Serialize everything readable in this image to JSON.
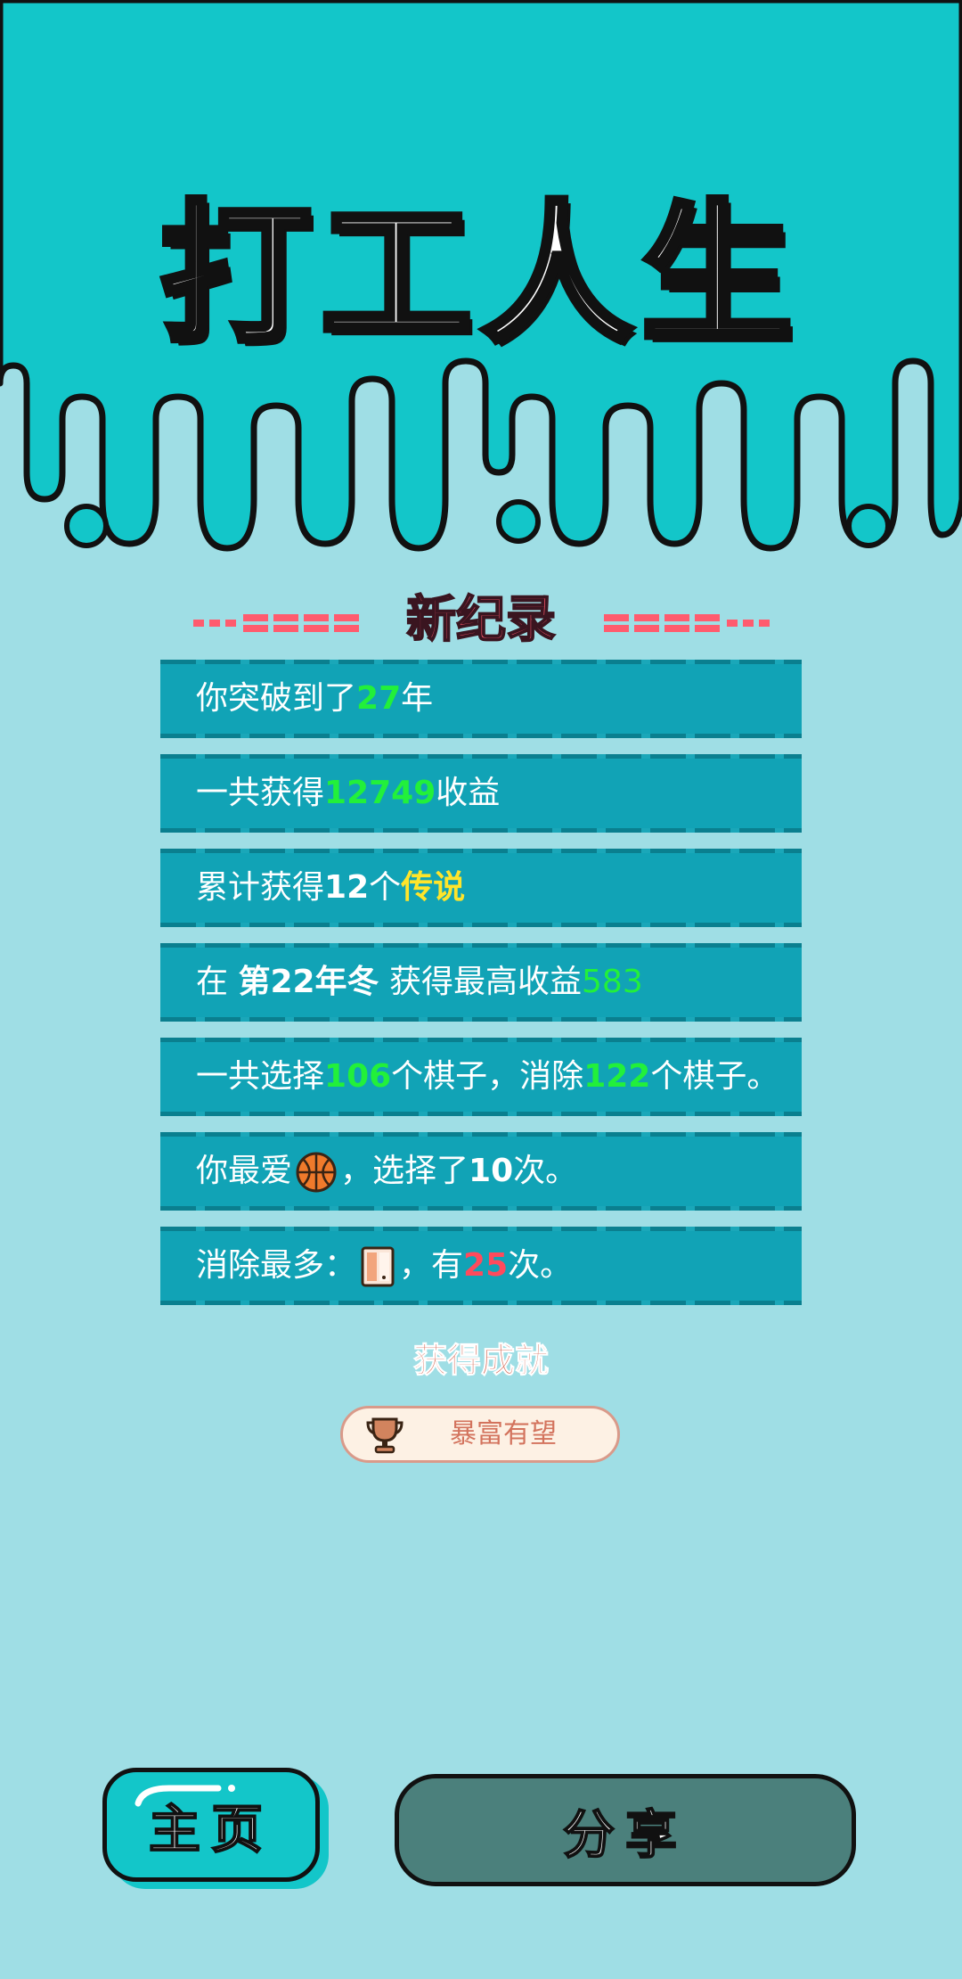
{
  "app": {
    "title": "打工人生"
  },
  "record": {
    "heading": "新纪录"
  },
  "stats": {
    "row1": {
      "prefix": "你突破到了",
      "value": "27",
      "suffix": "年"
    },
    "row2": {
      "prefix": "一共获得",
      "value": "12749",
      "suffix": "收益"
    },
    "row3": {
      "prefix": "累计获得",
      "count": "12",
      "mid": "个",
      "highlight": "传说"
    },
    "row4": {
      "prefix": "在 ",
      "period": "第22年冬",
      "mid": " 获得最高收益",
      "value": "583"
    },
    "row5": {
      "prefix": "一共选择",
      "chosen": "106",
      "mid": "个棋子，消除",
      "removed": "122",
      "suffix": "个棋子。"
    },
    "row6": {
      "prefix": "你最爱",
      "icon": "basketball-icon",
      "mid": "，选择了",
      "count": "10",
      "suffix": "次。"
    },
    "row7": {
      "prefix": "消除最多：",
      "icon": "door-icon",
      "mid": "，有",
      "count": "25",
      "suffix": "次。"
    }
  },
  "achievements": {
    "heading": "获得成就",
    "badge_label": "暴富有望",
    "badge_icon": "trophy-icon"
  },
  "buttons": {
    "home_label": "主页",
    "share_label": "分享"
  },
  "colors": {
    "background": "#9fdee5",
    "top_band": "#13c6c9",
    "row_bg": "#11a3b6",
    "highlight_green": "#22f03a",
    "highlight_yellow": "#ffe52a",
    "highlight_red": "#ff4a5c",
    "share_button": "#4b807c"
  }
}
